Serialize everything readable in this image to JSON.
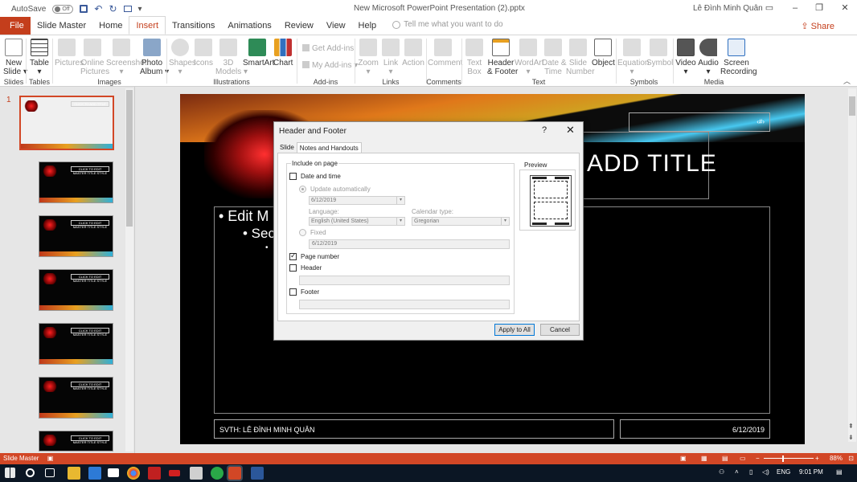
{
  "titlebar": {
    "autosave": "AutoSave",
    "autosave_state": "Off",
    "doc_title": "New Microsoft PowerPoint Presentation (2).pptx",
    "user": "Lê Đình Minh Quân"
  },
  "tabs": [
    "File",
    "Slide Master",
    "Home",
    "Insert",
    "Transitions",
    "Animations",
    "Review",
    "View",
    "Help"
  ],
  "tell_me": "Tell me what you want to do",
  "share": "Share",
  "ribbon": {
    "new_slide": "New\nSlide ▾",
    "table": "Table\n▾",
    "pictures": "Pictures",
    "online_pictures": "Online\nPictures",
    "screenshot": "Screenshot\n▾",
    "photo_album": "Photo\nAlbum ▾",
    "shapes": "Shapes\n▾",
    "icons": "Icons",
    "models": "3D\nModels ▾",
    "smartart": "SmartArt",
    "chart": "Chart",
    "get_addins": "Get Add-ins",
    "my_addins": "My Add-ins ▾",
    "zoom": "Zoom\n▾",
    "link": "Link\n▾",
    "action": "Action",
    "comment": "Comment",
    "textbox": "Text\nBox",
    "header_footer": "Header\n& Footer",
    "wordart": "WordArt\n▾",
    "datetime": "Date &\nTime",
    "slide_number": "Slide\nNumber",
    "object": "Object",
    "equation": "Equation\n▾",
    "symbol": "Symbol",
    "video": "Video\n▾",
    "audio": "Audio\n▾",
    "screen_recording": "Screen\nRecording",
    "groups": [
      "Slides",
      "Tables",
      "Images",
      "Illustrations",
      "Add-ins",
      "Links",
      "Comments",
      "Text",
      "Symbols",
      "Media"
    ]
  },
  "thumbs": {
    "num": "1",
    "t1": "CLICK TO ADD TITLE",
    "t2": "CLICK TO EDIT MASTER TITLE STYLE"
  },
  "slide": {
    "page": "‹#›",
    "title": "ADD TITLE",
    "b1": "• Edit M",
    "b2": "• Sec",
    "b3": "•",
    "footer": "SVTH: LÊ ĐÌNH MINH QUÂN",
    "date": "6/12/2019"
  },
  "dialog": {
    "title": "Header and Footer",
    "help": "?",
    "close": "✕",
    "tab_slide": "Slide",
    "tab_notes": "Notes and Handouts",
    "include": "Include on page",
    "date_time": "Date and time",
    "update_auto": "Update automatically",
    "date_value": "6/12/2019",
    "language_label": "Language:",
    "language": "English (United States)",
    "calendar_label": "Calendar type:",
    "calendar": "Gregorian",
    "fixed": "Fixed",
    "fixed_value": "6/12/2019",
    "page_number": "Page number",
    "header": "Header",
    "footer": "Footer",
    "preview": "Preview",
    "apply_all": "Apply to All",
    "cancel": "Cancel",
    "checked": {
      "date_time": false,
      "page_number": true,
      "header": false,
      "footer": false
    }
  },
  "status": {
    "view": "Slide Master",
    "zoom": "88%"
  },
  "taskbar": {
    "lang": "ENG",
    "time": "9:01 PM"
  }
}
